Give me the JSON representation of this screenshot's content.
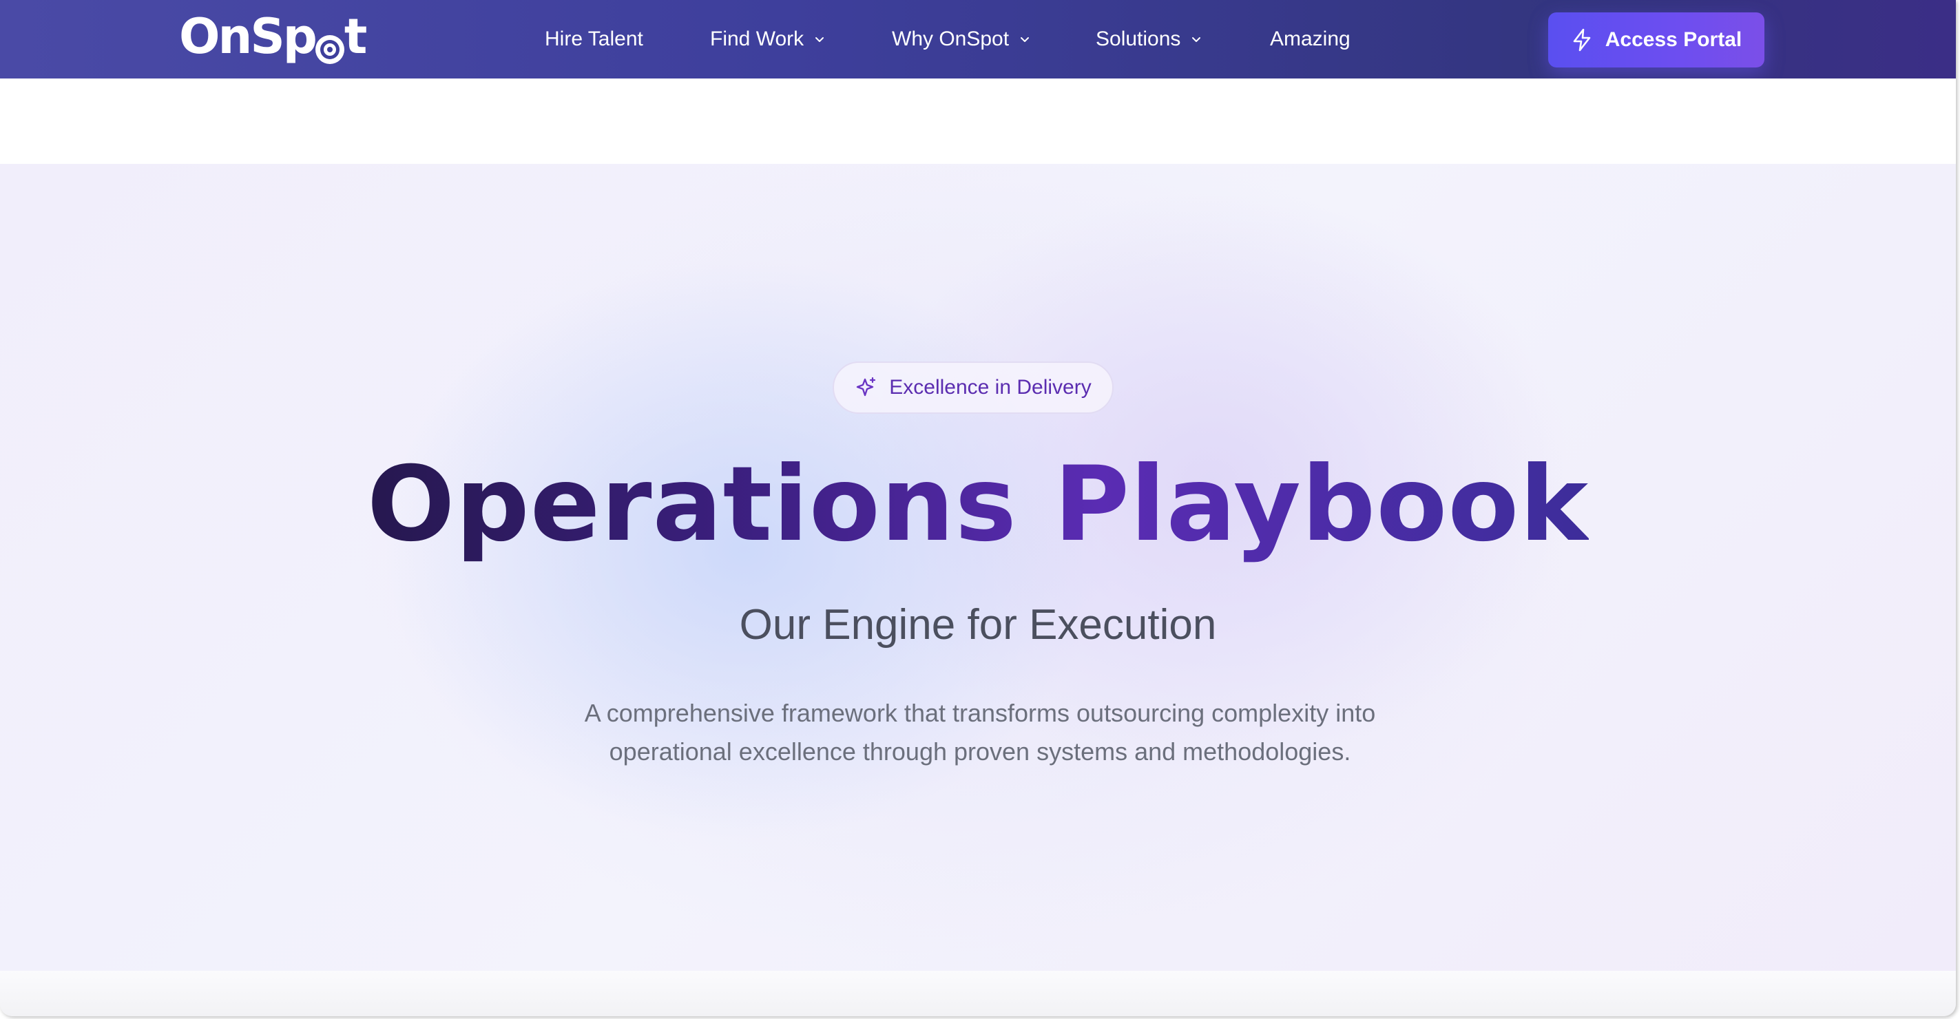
{
  "navbar": {
    "logo_text_left": "OnSp",
    "logo_text_right": "t",
    "items": [
      {
        "label": "Hire Talent",
        "has_dropdown": false
      },
      {
        "label": "Find Work",
        "has_dropdown": true
      },
      {
        "label": "Why OnSpot",
        "has_dropdown": true
      },
      {
        "label": "Solutions",
        "has_dropdown": true
      },
      {
        "label": "Amazing",
        "has_dropdown": false
      }
    ],
    "cta": {
      "label": "Access Portal",
      "icon": "lightning-icon"
    }
  },
  "hero": {
    "badge": {
      "label": "Excellence in Delivery",
      "icon": "sparkle-icon"
    },
    "title": "Operations Playbook",
    "subtitle": "Our Engine for Execution",
    "description_line1": "A comprehensive framework that transforms outsourcing complexity into",
    "description_line2": "operational excellence through proven systems and methodologies."
  },
  "colors": {
    "nav_bg": "#3e3f9c",
    "cta_bg": "#5a4ff0",
    "badge_text": "#5b2db0",
    "title_dark": "#26184f",
    "title_purple": "#5a2cb3"
  }
}
